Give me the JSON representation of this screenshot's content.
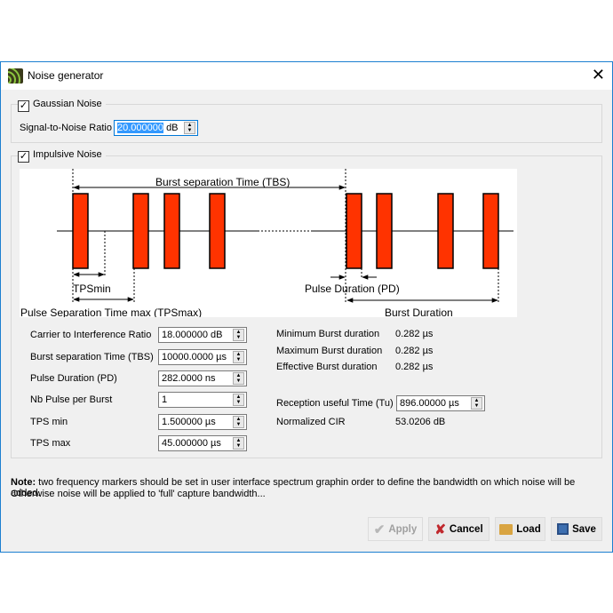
{
  "window": {
    "title": "Noise generator",
    "close_icon": "close-icon",
    "app_icon": "signal-waves-icon"
  },
  "gaussian": {
    "label": "Gaussian Noise",
    "checked": true,
    "snr_label": "Signal-to-Noise Ratio",
    "snr_value": "20.000000",
    "snr_unit": "dB"
  },
  "impulsive": {
    "label": "Impulsive Noise",
    "checked": true,
    "diagram": {
      "tbs": "Burst separation Time (TBS)",
      "tpsmin": "TPSmin",
      "tpsmax": "Pulse Separation Time max (TPSmax)",
      "pd": "Pulse Duration (PD)",
      "burst": "Burst Duration",
      "pulse_color": "#ff3300"
    },
    "fields": [
      {
        "label": "Carrier to Interference Ratio",
        "value": "18.000000 dB"
      },
      {
        "label": "Burst separation Time (TBS)",
        "value": "10000.0000 µs"
      },
      {
        "label": "Pulse Duration (PD)",
        "value": "282.0000 ns"
      },
      {
        "label": "Nb Pulse per Burst",
        "value": "1"
      },
      {
        "label": "TPS min",
        "value": "1.500000 µs"
      },
      {
        "label": "TPS max",
        "value": "45.000000 µs"
      }
    ],
    "info": [
      {
        "label": "Minimum Burst duration",
        "value": "0.282 µs"
      },
      {
        "label": "Maximum Burst duration",
        "value": "0.282 µs"
      },
      {
        "label": "Effective Burst duration",
        "value": "0.282 µs"
      }
    ],
    "tu": {
      "label": "Reception useful Time (Tu)",
      "value": "896.00000 µs"
    },
    "cir": {
      "label": "Normalized CIR",
      "value": "53.0206 dB"
    }
  },
  "note": {
    "bold": "Note:",
    "text": " two frequency markers should be set in user interface spectrum graphin order to define the bandwidth on which noise will be added.",
    "line2": "Otherwise noise will be applied to 'full' capture bandwidth..."
  },
  "buttons": {
    "apply": "Apply",
    "cancel": "Cancel",
    "load": "Load",
    "save": "Save"
  }
}
